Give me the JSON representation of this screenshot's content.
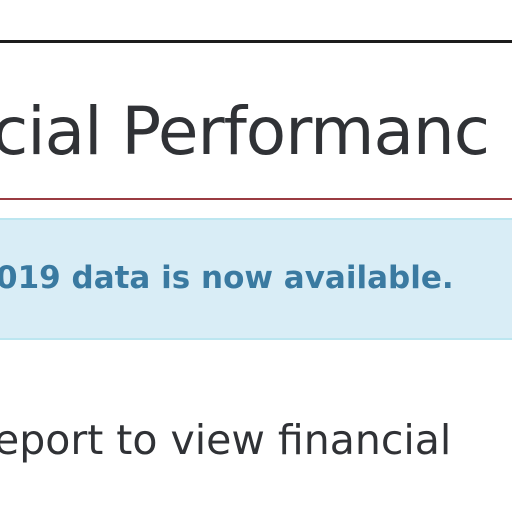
{
  "header": {
    "title": "cial Performanc"
  },
  "alert": {
    "message": "019 data is now available."
  },
  "main": {
    "intro_text": "eport to view financial"
  },
  "colors": {
    "title_text": "#303236",
    "title_underline": "#9a3b41",
    "alert_background": "#d9edf6",
    "alert_border": "#bce6f0",
    "alert_text": "#3a7aa1",
    "top_rule": "#1c1c1c"
  }
}
